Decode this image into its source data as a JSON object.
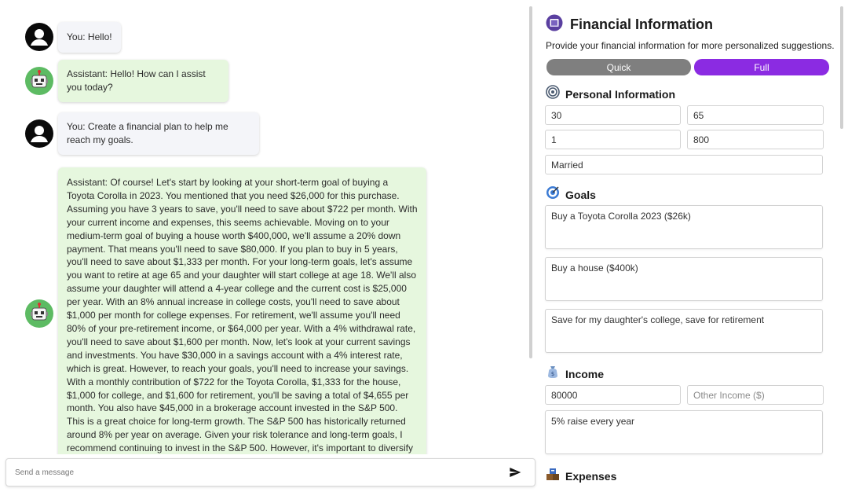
{
  "chat": {
    "messages": [
      {
        "role": "user",
        "text": "You: Hello!"
      },
      {
        "role": "assistant",
        "text": "Assistant: Hello! How can I assist you today?"
      },
      {
        "role": "user",
        "text": "You: Create a financial plan to help me reach my goals."
      },
      {
        "role": "assistant",
        "text": "Assistant: Of course! Let's start by looking at your short-term goal of buying a Toyota Corolla in 2023. You mentioned that you need $26,000 for this purchase. Assuming you have 3 years to save, you'll need to save about $722 per month. With your current income and expenses, this seems achievable. Moving on to your medium-term goal of buying a house worth $400,000, we'll assume a 20% down payment. That means you'll need to save $80,000. If you plan to buy in 5 years, you'll need to save about $1,333 per month. For your long-term goals, let's assume you want to retire at age 65 and your daughter will start college at age 18. We'll also assume your daughter will attend a 4-year college and the current cost is $25,000 per year. With an 8% annual increase in college costs, you'll need to save about $1,000 per month for college expenses. For retirement, we'll assume you'll need 80% of your pre-retirement income, or $64,000 per year. With a 4% withdrawal rate, you'll need to save about $1,600 per month. Now, let's look at your current savings and investments. You have $30,000 in a savings account with a 4% interest rate, which is great. However, to reach your goals, you'll need to increase your savings. With a monthly contribution of $722 for the Toyota Corolla, $1,333 for the house, $1,000 for college, and $1,600 for retirement, you'll be saving a total of $4,655 per month. You also have $45,000 in a brokerage account invested in the S&P 500. This is a great choice for long-term growth. The S&P 500 has historically returned around 8% per year on average. Given your risk tolerance and long-term goals, I recommend continuing to invest in the S&P 500. However, it's important to diversify your investments. Consider adding other asset classes like bonds and international stocks to reduce risk. To"
      }
    ],
    "input_placeholder": "Send a message"
  },
  "financial": {
    "title": "Financial Information",
    "description": "Provide your financial information for more personalized suggestions.",
    "tabs": {
      "quick": "Quick",
      "full": "Full"
    },
    "personal": {
      "title": "Personal Information",
      "age": "30",
      "retirement_age": "65",
      "dependents": "1",
      "credit_score": "800",
      "marital_status": "Married"
    },
    "goals": {
      "title": "Goals",
      "short_term": "Buy a Toyota Corolla 2023 ($26k)",
      "medium_term": "Buy a house ($400k)",
      "long_term": "Save for my daughter's college, save for retirement"
    },
    "income": {
      "title": "Income",
      "salary": "80000",
      "other_income_placeholder": "Other Income ($)",
      "notes": "5% raise every year"
    },
    "expenses": {
      "title": "Expenses"
    }
  },
  "colors": {
    "accent": "#8b2be2",
    "tab_inactive": "#7f7f7f",
    "assistant_bubble": "#e6f7de",
    "user_bubble": "#f4f5f9",
    "bot_avatar": "#5dbb63"
  }
}
